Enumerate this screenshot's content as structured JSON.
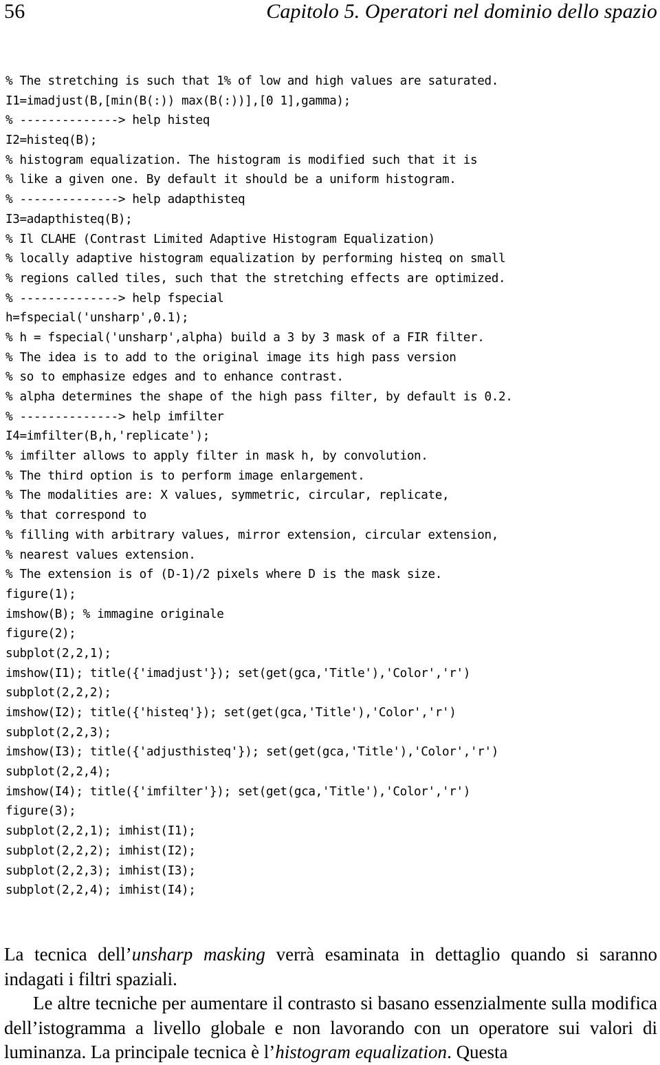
{
  "header": {
    "folio": "56",
    "title": "Capitolo 5.  Operatori nel dominio dello spazio"
  },
  "code": {
    "language": "matlab",
    "lines": [
      "% The stretching is such that 1% of low and high values are saturated.",
      "I1=imadjust(B,[min(B(:)) max(B(:))],[0 1],gamma);",
      "% --------------> help histeq",
      "I2=histeq(B);",
      "% histogram equalization. The histogram is modified such that it is",
      "% like a given one. By default it should be a uniform histogram.",
      "% --------------> help adapthisteq",
      "I3=adapthisteq(B);",
      "% Il CLAHE (Contrast Limited Adaptive Histogram Equalization)",
      "% locally adaptive histogram equalization by performing histeq on small",
      "% regions called tiles, such that the stretching effects are optimized.",
      "% --------------> help fspecial",
      "h=fspecial('unsharp',0.1);",
      "% h = fspecial('unsharp',alpha) build a 3 by 3 mask of a FIR filter.",
      "% The idea is to add to the original image its high pass version",
      "% so to emphasize edges and to enhance contrast.",
      "% alpha determines the shape of the high pass filter, by default is 0.2.",
      "% --------------> help imfilter",
      "I4=imfilter(B,h,'replicate');",
      "% imfilter allows to apply filter in mask h, by convolution.",
      "% The third option is to perform image enlargement.",
      "% The modalities are: X values, symmetric, circular, replicate,",
      "% that correspond to",
      "% filling with arbitrary values, mirror extension, circular extension,",
      "% nearest values extension.",
      "% The extension is of (D-1)/2 pixels where D is the mask size.",
      "figure(1);",
      "imshow(B); % immagine originale",
      "figure(2);",
      "subplot(2,2,1);",
      "imshow(I1); title({'imadjust'}); set(get(gca,'Title'),'Color','r')",
      "subplot(2,2,2);",
      "imshow(I2); title({'histeq'}); set(get(gca,'Title'),'Color','r')",
      "subplot(2,2,3);",
      "imshow(I3); title({'adjusthisteq'}); set(get(gca,'Title'),'Color','r')",
      "subplot(2,2,4);",
      "imshow(I4); title({'imfilter'}); set(get(gca,'Title'),'Color','r')",
      "figure(3);",
      "subplot(2,2,1); imhist(I1);",
      "subplot(2,2,2); imhist(I2);",
      "subplot(2,2,3); imhist(I3);",
      "subplot(2,2,4); imhist(I4);"
    ]
  },
  "paragraphs": {
    "p1": {
      "before_italic": "La tecnica dell’",
      "italic": "unsharp masking",
      "after_italic": " verrà esaminata in dettaglio quando si saranno indagati i filtri spaziali."
    },
    "p2": {
      "before_italic": "Le altre tecniche per aumentare il contrasto si basano essenzialmente sulla modifica dell’istogramma a livello globale e non lavorando con un operatore sui valori di luminanza. La principale tecnica è l’",
      "italic": "histogram equalization",
      "after_italic": ". Questa"
    }
  }
}
